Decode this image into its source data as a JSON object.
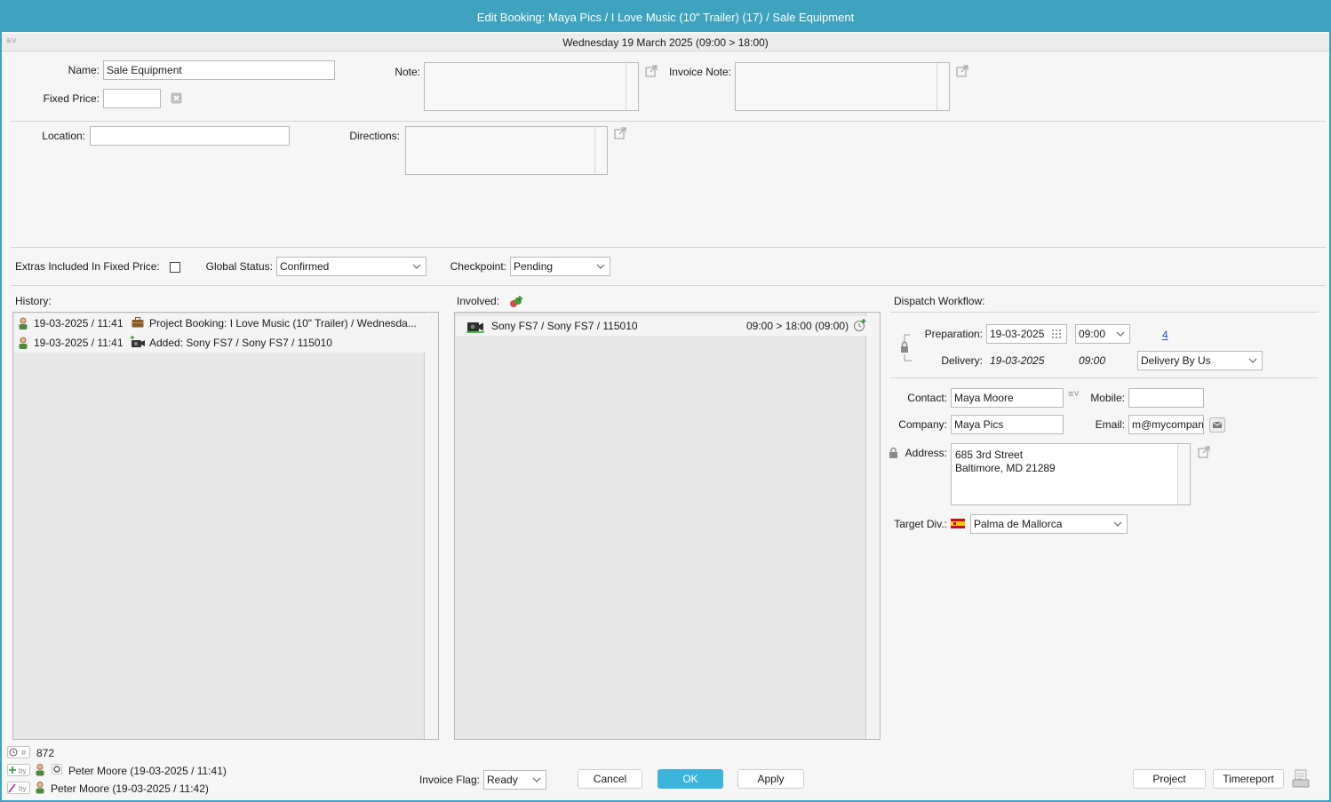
{
  "window": {
    "title": "Edit Booking: Maya Pics / I Love Music (10\" Trailer) (17) / Sale Equipment",
    "date_range": "Wednesday 19 March 2025 (09:00 > 18:00)"
  },
  "form": {
    "name_label": "Name:",
    "name_value": "Sale Equipment",
    "fixed_price_label": "Fixed Price:",
    "fixed_price_value": "",
    "note_label": "Note:",
    "invoice_note_label": "Invoice Note:",
    "location_label": "Location:",
    "location_value": "",
    "directions_label": "Directions:",
    "extras_label": "Extras Included In Fixed Price:",
    "global_status_label": "Global Status:",
    "global_status_value": "Confirmed",
    "checkpoint_label": "Checkpoint:",
    "checkpoint_value": "Pending"
  },
  "history": {
    "label": "History:",
    "rows": [
      {
        "timestamp": "19-03-2025 / 11:41",
        "text": "Project Booking: I Love Music (10\" Trailer) / Wednesda..."
      },
      {
        "timestamp": "19-03-2025 / 11:41",
        "text": "Added: Sony FS7 / Sony FS7 / 115010"
      }
    ]
  },
  "involved": {
    "label": "Involved:",
    "rows": [
      {
        "name": "Sony FS7 / Sony FS7 / 115010",
        "time": "09:00 > 18:00 (09:00)"
      }
    ]
  },
  "dispatch": {
    "label": "Dispatch Workflow:",
    "preparation_label": "Preparation:",
    "preparation_date": "19-03-2025",
    "preparation_time": "09:00",
    "preparation_link": "4",
    "delivery_label": "Delivery:",
    "delivery_date": "19-03-2025",
    "delivery_time": "09:00",
    "delivery_method": "Delivery By Us",
    "contact_label": "Contact:",
    "contact_value": "Maya Moore",
    "mobile_label": "Mobile:",
    "mobile_value": "",
    "company_label": "Company:",
    "company_value": "Maya Pics",
    "email_label": "Email:",
    "email_value": "m@mycompan",
    "address_label": "Address:",
    "address_line1": "685 3rd Street",
    "address_line2": "Baltimore, MD 21289",
    "target_div_label": "Target Div.:",
    "target_div_value": "Palma de Mallorca"
  },
  "footer": {
    "id_value": "872",
    "created_by": "Peter Moore (19-03-2025 / 11:41)",
    "modified_by": "Peter Moore (19-03-2025 / 11:42)",
    "invoice_flag_label": "Invoice Flag:",
    "invoice_flag_value": "Ready",
    "cancel_label": "Cancel",
    "ok_label": "OK",
    "apply_label": "Apply",
    "project_label": "Project",
    "timereport_label": "Timereport",
    "hash_symbol": "#",
    "by_label": "by"
  },
  "colors": {
    "title_bar": "#3fa3bf",
    "primary_button": "#3cb4dc",
    "link": "#2a4fc4"
  }
}
